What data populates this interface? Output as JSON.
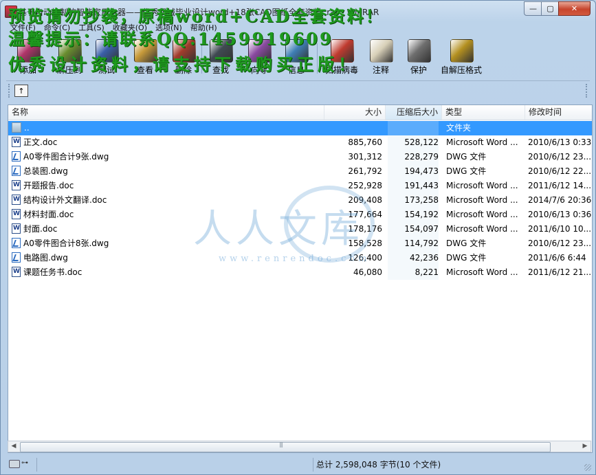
{
  "window": {
    "title": "基于自动控制的智能家用电器——优秀机械毕业设计word+18张CAD图纸全套资料 .rar - WinRAR",
    "controls": {
      "minimize": "—",
      "maximize": "▢",
      "close": "✕"
    }
  },
  "menu": [
    "文件(F)",
    "命令(C)",
    "工具(S)",
    "收藏夹(O)",
    "选项(N)",
    "帮助(H)"
  ],
  "toolbar": [
    {
      "label": "添加",
      "icon": "add-archive-icon",
      "color": "#b0356a"
    },
    {
      "label": "解压到",
      "icon": "extract-to-icon",
      "color": "#6a8e2f"
    },
    {
      "label": "测试",
      "icon": "test-archive-icon",
      "color": "#3a5fa8"
    },
    {
      "label": "查看",
      "icon": "view-glasses-icon",
      "color": "#c79a3a"
    },
    {
      "label": "删除",
      "icon": "delete-icon",
      "color": "#a23c2c"
    },
    {
      "label": "查找",
      "icon": "find-binoculars-icon",
      "color": "#404a52"
    },
    {
      "label": "向导",
      "icon": "wizard-icon",
      "color": "#8a4aa0"
    },
    {
      "label": "信息",
      "icon": "info-icon",
      "color": "#3f7fb5"
    },
    {
      "label": "扫描病毒",
      "icon": "virus-scan-icon",
      "color": "#c03b2f"
    },
    {
      "label": "注释",
      "icon": "comment-icon",
      "color": "#d8d0b8"
    },
    {
      "label": "保护",
      "icon": "protect-shield-icon",
      "color": "#6f6f6f"
    },
    {
      "label": "自解压格式",
      "icon": "sfx-icon",
      "color": "#b49020"
    }
  ],
  "address": {
    "up_icon": "↑"
  },
  "columns": {
    "name": "名称",
    "size": "大小",
    "packed": "压缩后大小",
    "type": "类型",
    "modified": "修改时间"
  },
  "files": [
    {
      "name": "..",
      "size": "",
      "packed": "",
      "type": "文件夹",
      "modified": "",
      "icon": "folder",
      "selected": true
    },
    {
      "name": "正文.doc",
      "size": "885,760",
      "packed": "528,122",
      "type": "Microsoft Word ...",
      "modified": "2010/6/13 0:33",
      "icon": "doc"
    },
    {
      "name": "A0零件图合计9张.dwg",
      "size": "301,312",
      "packed": "228,279",
      "type": "DWG 文件",
      "modified": "2010/6/12 23...",
      "icon": "dwg"
    },
    {
      "name": "总装图.dwg",
      "size": "261,792",
      "packed": "194,473",
      "type": "DWG 文件",
      "modified": "2010/6/12 22...",
      "icon": "dwg"
    },
    {
      "name": "开题报告.doc",
      "size": "252,928",
      "packed": "191,443",
      "type": "Microsoft Word ...",
      "modified": "2011/6/12 14...",
      "icon": "doc"
    },
    {
      "name": "结构设计外文翻译.doc",
      "size": "209,408",
      "packed": "173,258",
      "type": "Microsoft Word ...",
      "modified": "2014/7/6 20:36",
      "icon": "doc"
    },
    {
      "name": "材料封面.doc",
      "size": "177,664",
      "packed": "154,192",
      "type": "Microsoft Word ...",
      "modified": "2010/6/13 0:36",
      "icon": "doc"
    },
    {
      "name": "封面.doc",
      "size": "178,176",
      "packed": "154,097",
      "type": "Microsoft Word ...",
      "modified": "2011/6/10 10...",
      "icon": "doc"
    },
    {
      "name": "A0零件图合计8张.dwg",
      "size": "158,528",
      "packed": "114,792",
      "type": "DWG 文件",
      "modified": "2010/6/12 23...",
      "icon": "dwg"
    },
    {
      "name": "电路图.dwg",
      "size": "126,400",
      "packed": "42,236",
      "type": "DWG 文件",
      "modified": "2011/6/6 6:44",
      "icon": "dwg"
    },
    {
      "name": "课题任务书.doc",
      "size": "46,080",
      "packed": "8,221",
      "type": "Microsoft Word ...",
      "modified": "2011/6/12 21...",
      "icon": "doc"
    }
  ],
  "status": {
    "total": "总计 2,598,048 字节(10 个文件)"
  },
  "overlay": {
    "line1": "预览请勿抄袭，原稿word+CAD全套资料！",
    "line2": "温馨提示：请联系QQ:1459919609",
    "line3": "优秀设计资料，请支持下载购买正版！",
    "center_big": "人人文库",
    "center_url": "www.renrendoc.com"
  },
  "colors": {
    "selection": "#3399ff",
    "overlay_text": "#1e9a1e",
    "watermark": "#5a9bd2"
  }
}
